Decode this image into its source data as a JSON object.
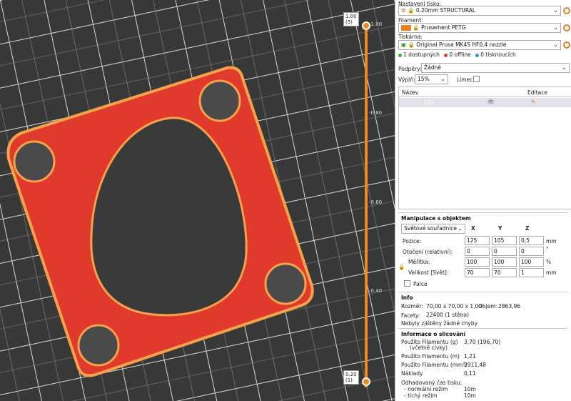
{
  "slider": {
    "top_value": "1.00",
    "top_layer": "(5)",
    "bottom_value": "0.20",
    "bottom_layer": "(1)",
    "ticks": [
      "-1.00",
      "-0.80",
      "-0.60",
      "-0.40"
    ]
  },
  "print_settings": {
    "label": "Nastavení tisku:",
    "value": "0.20mm STRUCTURAL"
  },
  "filament": {
    "label": "Filament:",
    "value": "Prusament PETG",
    "color": "#f07e1b"
  },
  "printer": {
    "label": "Tiskárna:",
    "value": "Original Prusa MK4S HF0.4 nozzle"
  },
  "printer_status": {
    "available": "1 dostupných",
    "offline_count": "0",
    "offline": "offline",
    "printing_count": "0",
    "printing": "tisknoucích"
  },
  "supports": {
    "label": "Podpěry:",
    "value": "Žádné"
  },
  "infill": {
    "label": "Výplň:",
    "value": "15%"
  },
  "brim": {
    "label": "Límec:"
  },
  "object_list": {
    "col_name": "Název",
    "col_edit": "Editace",
    "item": "100"
  },
  "manip": {
    "title": "Manipulace s objektem",
    "coord": "Světové souřadnice",
    "x": "X",
    "y": "Y",
    "z": "Z",
    "pos_label": "Pozice:",
    "pos": [
      "125",
      "105",
      "0,5"
    ],
    "pos_unit": "mm",
    "rot_label": "Otočení (relativní):",
    "rot": [
      "0",
      "0",
      "0"
    ],
    "rot_unit": "°",
    "scale_label": "Měřítka:",
    "scale": [
      "100",
      "100",
      "100"
    ],
    "scale_unit": "%",
    "size_label": "Velikost [Svět]:",
    "size": [
      "70",
      "70",
      "1"
    ],
    "size_unit": "mm",
    "inches": "Palce"
  },
  "info": {
    "title": "Info",
    "size_label": "Rozměr:",
    "size": "70,00 x 70,00 x 1,00",
    "volume_label": "Objem:",
    "volume": "2863,96",
    "facets_label": "Facety:",
    "facets": "22400 (1 stěna)",
    "errors": "Nebyly zjištěny žádné chyby"
  },
  "slice": {
    "title": "Informace o slicování",
    "rows": [
      {
        "label": "Použito Filamentu (g)",
        "label2": "(včetně cívky)",
        "value": "3,70 (196,70)"
      },
      {
        "label": "Použito Filamentu (m)",
        "value": "1,21"
      },
      {
        "label": "Použito Filamentu (mm³)",
        "value": "2911,48"
      },
      {
        "label": "Náklady",
        "value": "0,11"
      }
    ],
    "time_label": "Odhadovaný čas tisku:",
    "normal_label": "- normální režim",
    "normal": "10m",
    "quiet_label": "- tichý režim",
    "quiet": "10m"
  }
}
